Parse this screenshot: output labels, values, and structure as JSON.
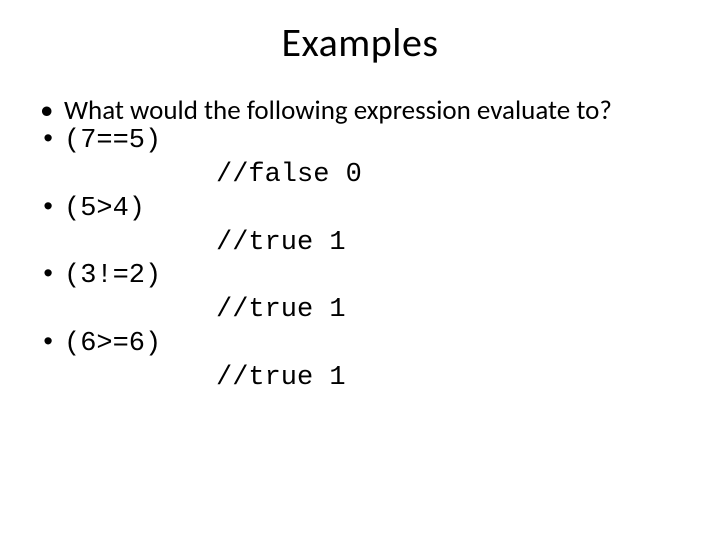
{
  "title": "Examples",
  "intro": "What would the following expression evaluate to?",
  "items": [
    {
      "expr": "(7==5)",
      "answer": "//false 0"
    },
    {
      "expr": "(5>4)",
      "answer": "//true 1"
    },
    {
      "expr": "(3!=2)",
      "answer": "//true 1"
    },
    {
      "expr": "(6>=6)",
      "answer": "//true 1"
    }
  ]
}
